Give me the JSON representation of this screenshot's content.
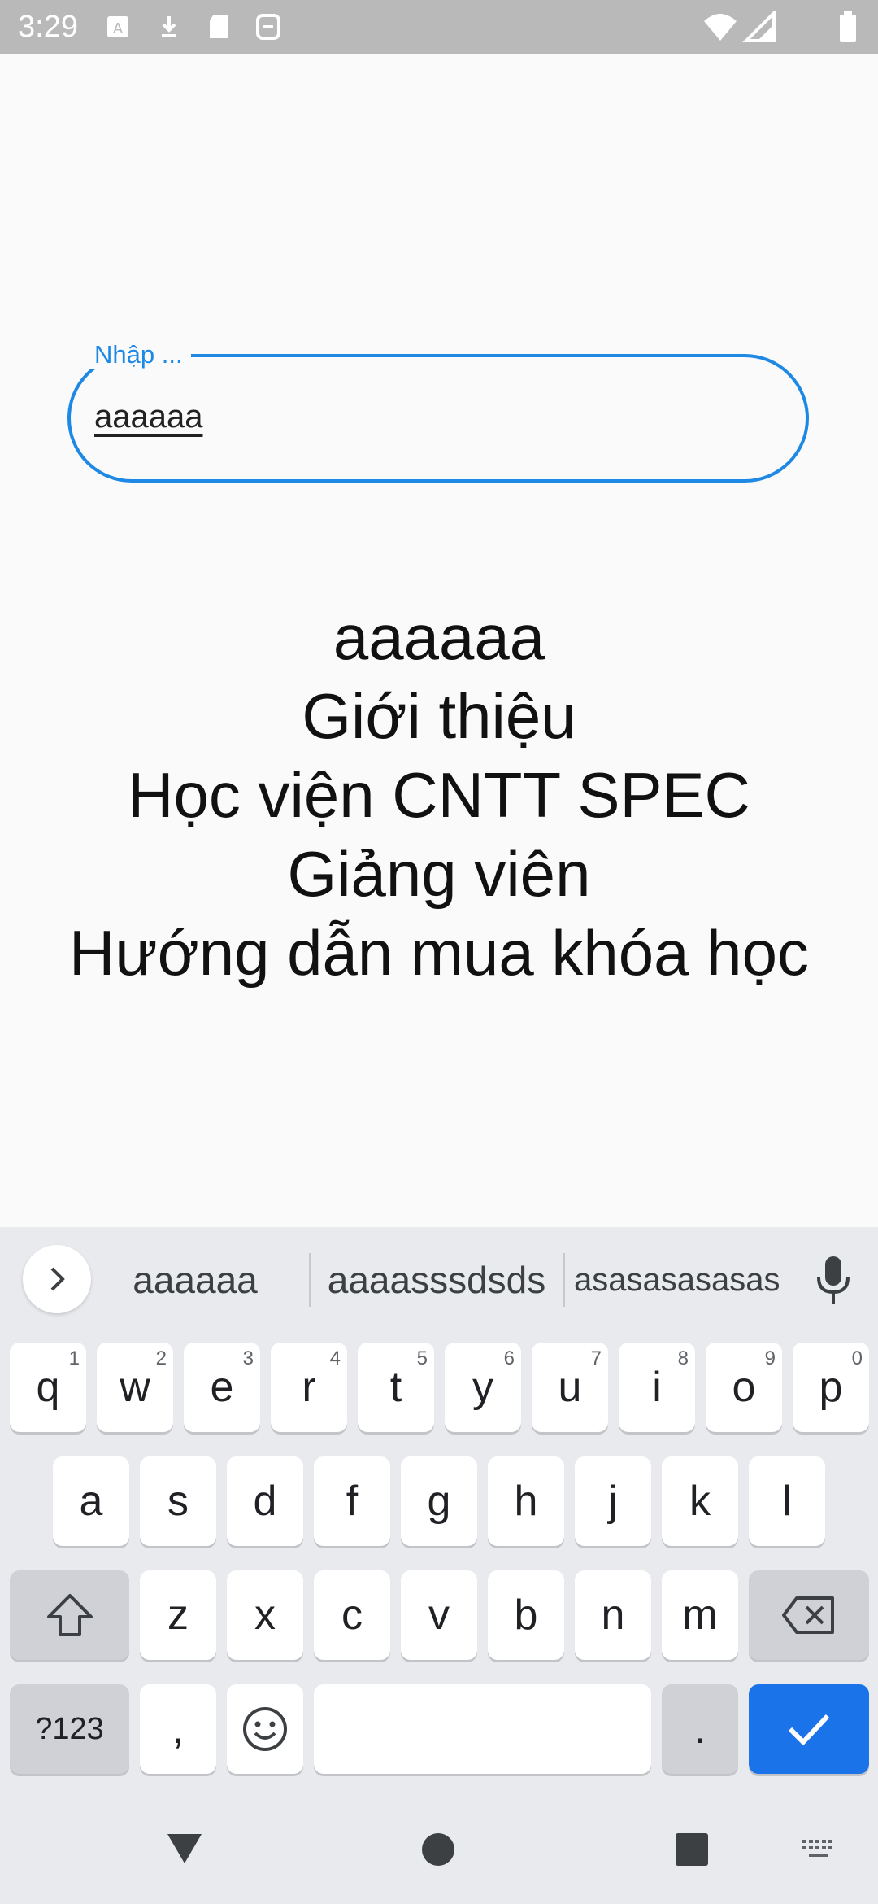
{
  "status_bar": {
    "time": "3:29"
  },
  "text_field": {
    "label": "Nhập ...",
    "value": "aaaaaa"
  },
  "content": {
    "lines": [
      "aaaaaa",
      "Giới thiệu",
      "Học viện CNTT SPEC",
      "Giảng viên",
      "Hướng dẫn mua khóa học"
    ]
  },
  "keyboard": {
    "suggestions": [
      "aaaaaa",
      "aaaasssdsds",
      "asasasasasas"
    ],
    "row1": [
      {
        "k": "q",
        "h": "1"
      },
      {
        "k": "w",
        "h": "2"
      },
      {
        "k": "e",
        "h": "3"
      },
      {
        "k": "r",
        "h": "4"
      },
      {
        "k": "t",
        "h": "5"
      },
      {
        "k": "y",
        "h": "6"
      },
      {
        "k": "u",
        "h": "7"
      },
      {
        "k": "i",
        "h": "8"
      },
      {
        "k": "o",
        "h": "9"
      },
      {
        "k": "p",
        "h": "0"
      }
    ],
    "row2": [
      "a",
      "s",
      "d",
      "f",
      "g",
      "h",
      "j",
      "k",
      "l"
    ],
    "row3": [
      "z",
      "x",
      "c",
      "v",
      "b",
      "n",
      "m"
    ],
    "symbols_label": "?123",
    "comma": ",",
    "period": "."
  },
  "colors": {
    "accent": "#1e88e5",
    "action_key": "#1a73e8"
  }
}
